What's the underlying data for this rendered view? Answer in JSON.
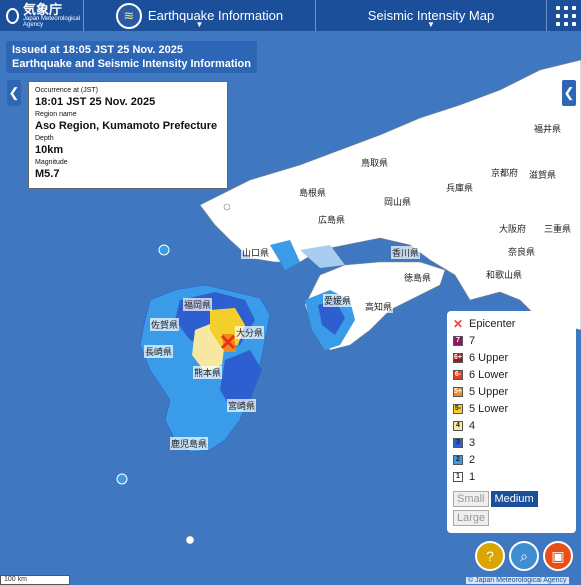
{
  "header": {
    "logo_jp": "気象庁",
    "logo_en": "Japan Meteorological Agency",
    "nav_earthquake": "Earthquake Information",
    "nav_intensity": "Seismic Intensity Map"
  },
  "banner": {
    "line1": "Issued at 18:05 JST 25 Nov. 2025",
    "line2": "Earthquake and Seismic Intensity Information"
  },
  "info": {
    "occurrence_label": "Occurrence at (JST)",
    "occurrence": "18:01 JST 25 Nov. 2025",
    "region_label": "Region name",
    "region": "Aso Region, Kumamoto Prefecture",
    "depth_label": "Depth",
    "depth": "10km",
    "magnitude_label": "Magnitude",
    "magnitude": "M5.7"
  },
  "legend": {
    "epicenter": "Epicenter",
    "levels": [
      {
        "label": "7",
        "swatch": "7",
        "color": "#8b1a5b"
      },
      {
        "label": "6 Upper",
        "swatch": "6+",
        "color": "#9c1a1a"
      },
      {
        "label": "6 Lower",
        "swatch": "6-",
        "color": "#e0401a"
      },
      {
        "label": "5 Upper",
        "swatch": "5+",
        "color": "#f08a1a"
      },
      {
        "label": "5 Lower",
        "swatch": "5-",
        "color": "#f2cf2a"
      },
      {
        "label": "4",
        "swatch": "4",
        "color": "#f7e7a0"
      },
      {
        "label": "3",
        "swatch": "3",
        "color": "#2d5fd0"
      },
      {
        "label": "2",
        "swatch": "2",
        "color": "#3a9be8"
      },
      {
        "label": "1",
        "swatch": "1",
        "color": "#ffffff"
      }
    ],
    "size_small": "Small",
    "size_medium": "Medium",
    "size_large": "Large"
  },
  "map": {
    "scale": "100 km",
    "credit": "© Japan Meteorological Agency",
    "labels": [
      "鳥取県",
      "兵庫県",
      "京都府",
      "滋賀県",
      "福井県",
      "島根県",
      "岡山県",
      "大阪府",
      "三重県",
      "広島県",
      "香川県",
      "奈良県",
      "山口県",
      "徳島県",
      "和歌山県",
      "愛媛県",
      "高知県",
      "福岡県",
      "佐賀県",
      "長崎県",
      "大分県",
      "熊本県",
      "宮崎県",
      "鹿児島県"
    ]
  },
  "colors": {
    "sea": "#3f78c0",
    "land": "#ffffff",
    "header": "#1b4f9a"
  }
}
